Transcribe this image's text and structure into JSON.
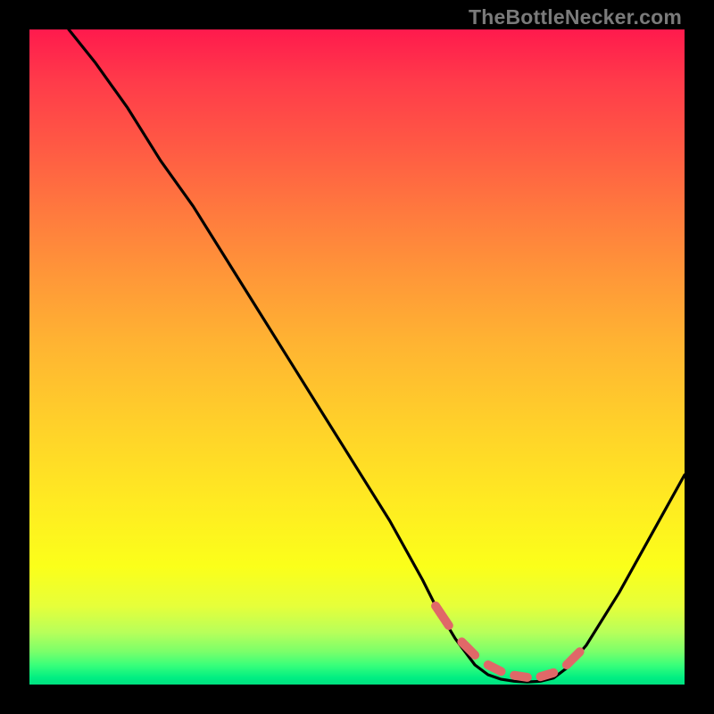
{
  "watermark": "TheBottleNecker.com",
  "chart_data": {
    "type": "line",
    "title": "",
    "xlabel": "",
    "ylabel": "",
    "xlim": [
      0,
      100
    ],
    "ylim": [
      0,
      100
    ],
    "series": [
      {
        "name": "bottleneck-curve",
        "x": [
          6,
          10,
          15,
          20,
          25,
          30,
          35,
          40,
          45,
          50,
          55,
          60,
          62,
          65,
          68,
          70,
          72,
          74,
          76,
          78,
          80,
          82,
          85,
          90,
          95,
          100
        ],
        "y": [
          100,
          95,
          88,
          80,
          73,
          65,
          57,
          49,
          41,
          33,
          25,
          16,
          12,
          7,
          3,
          1.5,
          0.8,
          0.5,
          0.4,
          0.5,
          1,
          2.5,
          6,
          14,
          23,
          32
        ]
      }
    ],
    "markers": {
      "name": "optimal-dots",
      "x": [
        62,
        64,
        66,
        68,
        70,
        72,
        74,
        76,
        78,
        80,
        82,
        84
      ],
      "y": [
        12,
        9,
        6.5,
        4.5,
        3,
        2,
        1.4,
        1.1,
        1.2,
        1.8,
        3,
        5
      ]
    },
    "gradient_colors": {
      "top": "#ff1a4d",
      "mid": "#ffea22",
      "bottom": "#00e080"
    }
  }
}
